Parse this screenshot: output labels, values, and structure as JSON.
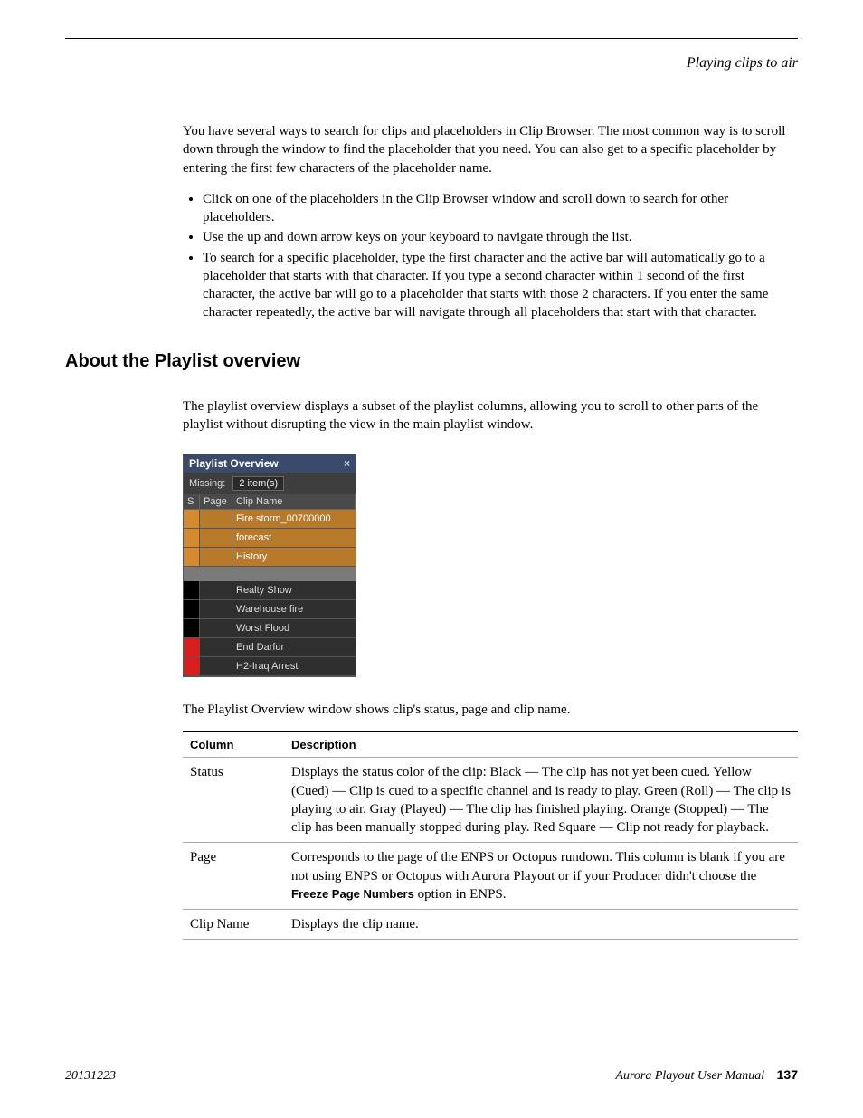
{
  "running_head": "Playing clips to air",
  "intro_para": "You have several ways to search for clips and placeholders in Clip Browser. The most common way is to scroll down through the window to find the placeholder that you need. You can also get to a specific placeholder by entering the first few characters of the placeholder name.",
  "bullets": [
    "Click on one of the placeholders in the Clip Browser window and scroll down to search for other placeholders.",
    "Use the up and down arrow keys on your keyboard to navigate through the list.",
    "To search for a specific placeholder, type the first character and the active bar will automatically go to a placeholder that starts with that character. If you type a second character within 1 second of the first character, the active bar will go to a placeholder that starts with those 2 characters. If you enter the same character repeatedly, the active bar will navigate through all placeholders that start with that character."
  ],
  "section_heading": "About the Playlist overview",
  "overview_para": "The playlist overview displays a subset of the playlist columns, allowing you to scroll to other parts of the playlist without disrupting the view in the main playlist window.",
  "widget": {
    "title": "Playlist Overview",
    "close": "×",
    "missing_label": "Missing:",
    "missing_count": "2 item(s)",
    "headers": {
      "s": "S",
      "page": "Page",
      "name": "Clip Name"
    },
    "rows_top": [
      {
        "name": "Fire storm_00700000"
      },
      {
        "name": "forecast"
      },
      {
        "name": "History"
      }
    ],
    "rows_bottom": [
      {
        "status": "none",
        "name": "Realty Show"
      },
      {
        "status": "none",
        "name": "Warehouse fire"
      },
      {
        "status": "none",
        "name": "Worst Flood"
      },
      {
        "status": "red",
        "name": "End Darfur"
      },
      {
        "status": "red",
        "name": "H2-Iraq Arrest"
      }
    ]
  },
  "caption_after_widget": "The Playlist Overview window shows clip's status, page and clip name.",
  "table": {
    "header_col": "Column",
    "header_desc": "Description",
    "rows": [
      {
        "col": "Status",
        "desc": "Displays the status color of the clip: Black — The clip has not yet been cued. Yellow (Cued) — Clip is cued to a specific channel and is ready to play. Green (Roll) — The clip is playing to air. Gray (Played) — The clip has finished playing. Orange (Stopped) — The clip has been manually stopped during play. Red Square — Clip not ready for playback."
      },
      {
        "col": "Page",
        "desc_pre": "Corresponds to the page of the ENPS or Octopus rundown. This column is blank if you are not using ENPS or Octopus with Aurora Playout or if your Producer didn't choose the ",
        "desc_bold": "Freeze Page Numbers",
        "desc_post": " option in ENPS."
      },
      {
        "col": "Clip Name",
        "desc": "Displays the clip name."
      }
    ]
  },
  "footer": {
    "date": "20131223",
    "book": "Aurora Playout   User Manual",
    "page": "137"
  }
}
